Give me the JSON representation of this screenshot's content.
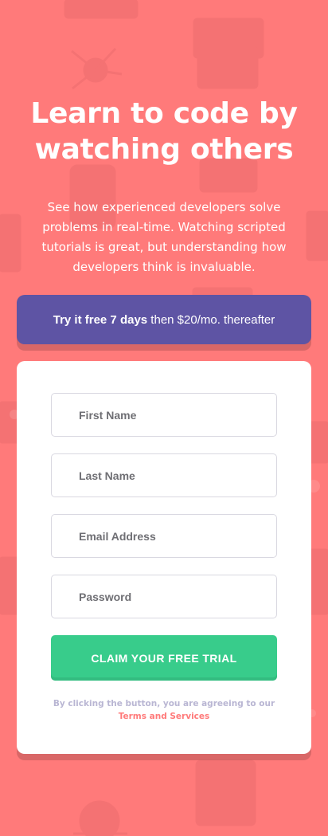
{
  "colors": {
    "background": "#ff7a7a",
    "banner": "#5e54a4",
    "button": "#38cc8b",
    "card": "#ffffff",
    "muted_text": "#b9b6d3",
    "link": "#ff7a7a"
  },
  "hero": {
    "title": "Learn to code by watching others",
    "description": "See how experienced developers solve problems in real-time. Watching scripted tutorials is great, but understanding how developers think is invaluable."
  },
  "offer": {
    "bold_text": "Try it free 7 days",
    "rest_text": " then $20/mo. thereafter"
  },
  "form": {
    "first_name_placeholder": "First Name",
    "last_name_placeholder": "Last Name",
    "email_placeholder": "Email Address",
    "password_placeholder": "Password",
    "submit_label": "CLAIM YOUR FREE TRIAL",
    "terms_prefix": "By clicking the button, you are agreeing to our",
    "terms_link": "Terms and Services"
  }
}
